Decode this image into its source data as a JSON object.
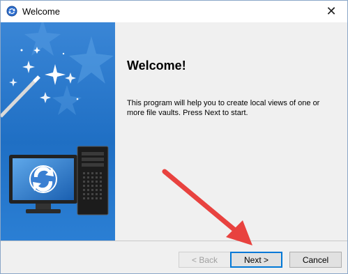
{
  "window": {
    "title": "Welcome",
    "app_icon": "sync-app-icon",
    "close_icon": "close-icon"
  },
  "page": {
    "heading": "Welcome!",
    "description": "This program will help you to create local views of one or more file vaults. Press Next to start."
  },
  "buttons": {
    "back": "< Back",
    "next": "Next >",
    "cancel": "Cancel"
  },
  "colors": {
    "banner_blue": "#1f6fc4",
    "annotation_arrow": "#e8423f",
    "default_button_border": "#0078d7"
  }
}
